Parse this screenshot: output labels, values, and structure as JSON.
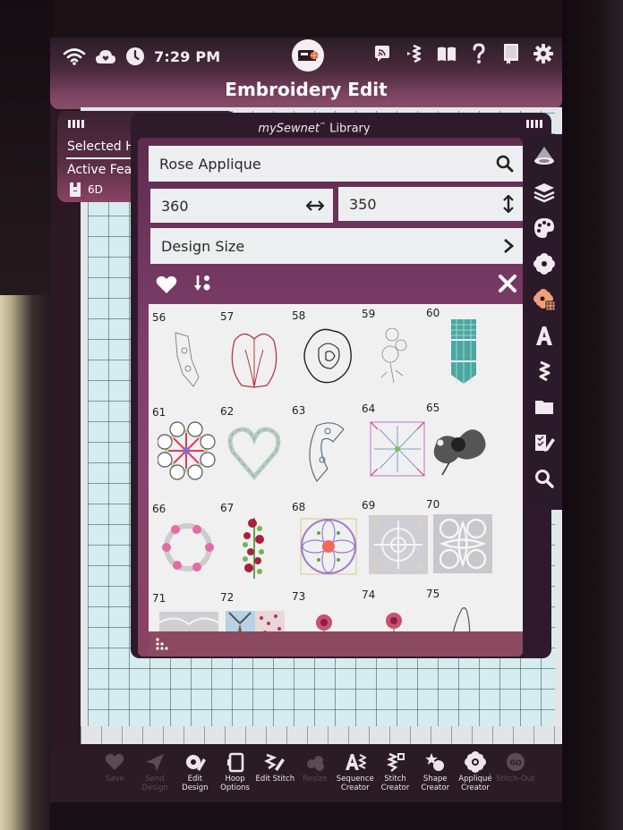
{
  "status_bar": {
    "time": "7:29 PM",
    "left_icons": [
      "wifi-icon",
      "cloud-heart-icon",
      "clock-icon"
    ],
    "center_icon": "sewing-machine-icon",
    "right_icons": [
      "cast-icon",
      "bluetooth-icon",
      "open-book-icon",
      "help-icon",
      "manual-icon",
      "settings-icon"
    ]
  },
  "header": {
    "title": "Embroidery Edit"
  },
  "left_panel": {
    "selected_label": "Selected H",
    "active_label": "Active Fea",
    "hoop_value": "6D"
  },
  "library": {
    "title_brand": "mySewnet",
    "title_tm": "™",
    "title_suffix": " Library",
    "search": {
      "value": "Rose Applique",
      "icon": "search-icon"
    },
    "width": {
      "value": "360",
      "icon": "horizontal-arrows-icon"
    },
    "height": {
      "value": "350",
      "icon": "vertical-arrows-icon"
    },
    "design_size": {
      "label": "Design Size",
      "icon": "chevron-right-icon"
    },
    "toolbar": {
      "favorite_icon": "heart-icon",
      "sort_icon": "sort-icon",
      "close_icon": "close-icon"
    },
    "designs": [
      {
        "num": "56",
        "kind": "outline-gray"
      },
      {
        "num": "57",
        "kind": "tulip-red"
      },
      {
        "num": "58",
        "kind": "rose-black"
      },
      {
        "num": "59",
        "kind": "floral-gray"
      },
      {
        "num": "60",
        "kind": "teal-pennant"
      },
      {
        "num": "61",
        "kind": "medallion-circles"
      },
      {
        "num": "62",
        "kind": "heart-wreath"
      },
      {
        "num": "63",
        "kind": "arc-segment"
      },
      {
        "num": "64",
        "kind": "square-star"
      },
      {
        "num": "65",
        "kind": "rose-scroll"
      },
      {
        "num": "66",
        "kind": "flower-wreath"
      },
      {
        "num": "67",
        "kind": "rose-vine"
      },
      {
        "num": "68",
        "kind": "medallion-purple"
      },
      {
        "num": "69",
        "kind": "lace-square"
      },
      {
        "num": "70",
        "kind": "lace-square-2"
      },
      {
        "num": "71",
        "kind": "lace-strip"
      },
      {
        "num": "72",
        "kind": "windmill-scene"
      },
      {
        "num": "73",
        "kind": "rose-small"
      },
      {
        "num": "74",
        "kind": "rose-small"
      },
      {
        "num": "75",
        "kind": "outline-thin"
      }
    ],
    "footer_icon": "dots-grip-icon"
  },
  "tool_strip": [
    {
      "name": "hoop-view",
      "icon": "pyramid-icon"
    },
    {
      "name": "layers",
      "icon": "layers-icon"
    },
    {
      "name": "colors",
      "icon": "palette-icon"
    },
    {
      "name": "designs",
      "icon": "flower-icon"
    },
    {
      "name": "design-library",
      "icon": "flower-grid-icon",
      "active": true
    },
    {
      "name": "fonts",
      "icon": "font-a-icon"
    },
    {
      "name": "stitches",
      "icon": "zigzag-icon"
    },
    {
      "name": "files",
      "icon": "folder-icon"
    },
    {
      "name": "edit-tools",
      "icon": "pencil-edit-icon"
    },
    {
      "name": "search",
      "icon": "search-icon"
    }
  ],
  "bottom_bar": [
    {
      "label": "Save",
      "icon": "heart-icon",
      "disabled": true
    },
    {
      "label": "Send Design",
      "icon": "send-icon",
      "disabled": true
    },
    {
      "label": "Edit Design",
      "icon": "edit-design-icon",
      "disabled": false
    },
    {
      "label": "Hoop Options",
      "icon": "hoop-icon",
      "disabled": false
    },
    {
      "label": "Edit Stitch",
      "icon": "edit-stitch-icon",
      "disabled": false
    },
    {
      "label": "Resize",
      "icon": "resize-icon",
      "disabled": true
    },
    {
      "label": "Sequence Creator",
      "icon": "sequence-icon",
      "disabled": false
    },
    {
      "label": "Stitch Creator",
      "icon": "stitch-creator-icon",
      "disabled": false
    },
    {
      "label": "Shape Creator",
      "icon": "shape-creator-icon",
      "disabled": false
    },
    {
      "label": "Appliqué Creator",
      "icon": "applique-icon",
      "disabled": false
    },
    {
      "label": "Stitch-Out",
      "icon": "go-icon",
      "disabled": true
    }
  ],
  "colors": {
    "accent": "#8a4d6b",
    "panel_dark": "#2f1a2b",
    "canvas": "#d6ecef",
    "active_tool": "#f2a07a"
  }
}
